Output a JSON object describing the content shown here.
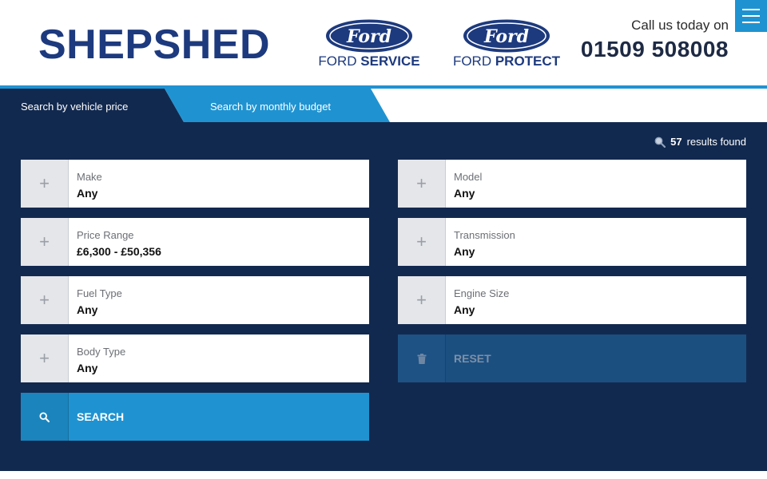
{
  "header": {
    "brand": "SHEPSHED",
    "logos": [
      {
        "oval_text": "Ford",
        "caption_light": "FORD ",
        "caption_bold": "SERVICE"
      },
      {
        "oval_text": "Ford",
        "caption_light": "FORD ",
        "caption_bold": "PROTECT"
      }
    ],
    "call_label": "Call us today on",
    "phone": "01509 508008",
    "menu_icon": "hamburger-icon"
  },
  "tabs": [
    {
      "label": "Search by vehicle price",
      "active": true
    },
    {
      "label": "Search by monthly budget",
      "active": false
    }
  ],
  "results": {
    "count": "57",
    "suffix": "results found",
    "icon": "search-icon"
  },
  "filters": [
    {
      "label": "Make",
      "value": "Any"
    },
    {
      "label": "Model",
      "value": "Any"
    },
    {
      "label": "Price Range",
      "value": "£6,300 - £50,356"
    },
    {
      "label": "Transmission",
      "value": "Any"
    },
    {
      "label": "Fuel Type",
      "value": "Any"
    },
    {
      "label": "Engine Size",
      "value": "Any"
    },
    {
      "label": "Body Type",
      "value": "Any"
    }
  ],
  "buttons": {
    "search": "SEARCH",
    "reset": "RESET"
  },
  "colors": {
    "brand_navy": "#1d3a7e",
    "accent_blue": "#1f93d1",
    "panel_navy": "#12294f",
    "reset_blue": "#1b4f80"
  }
}
